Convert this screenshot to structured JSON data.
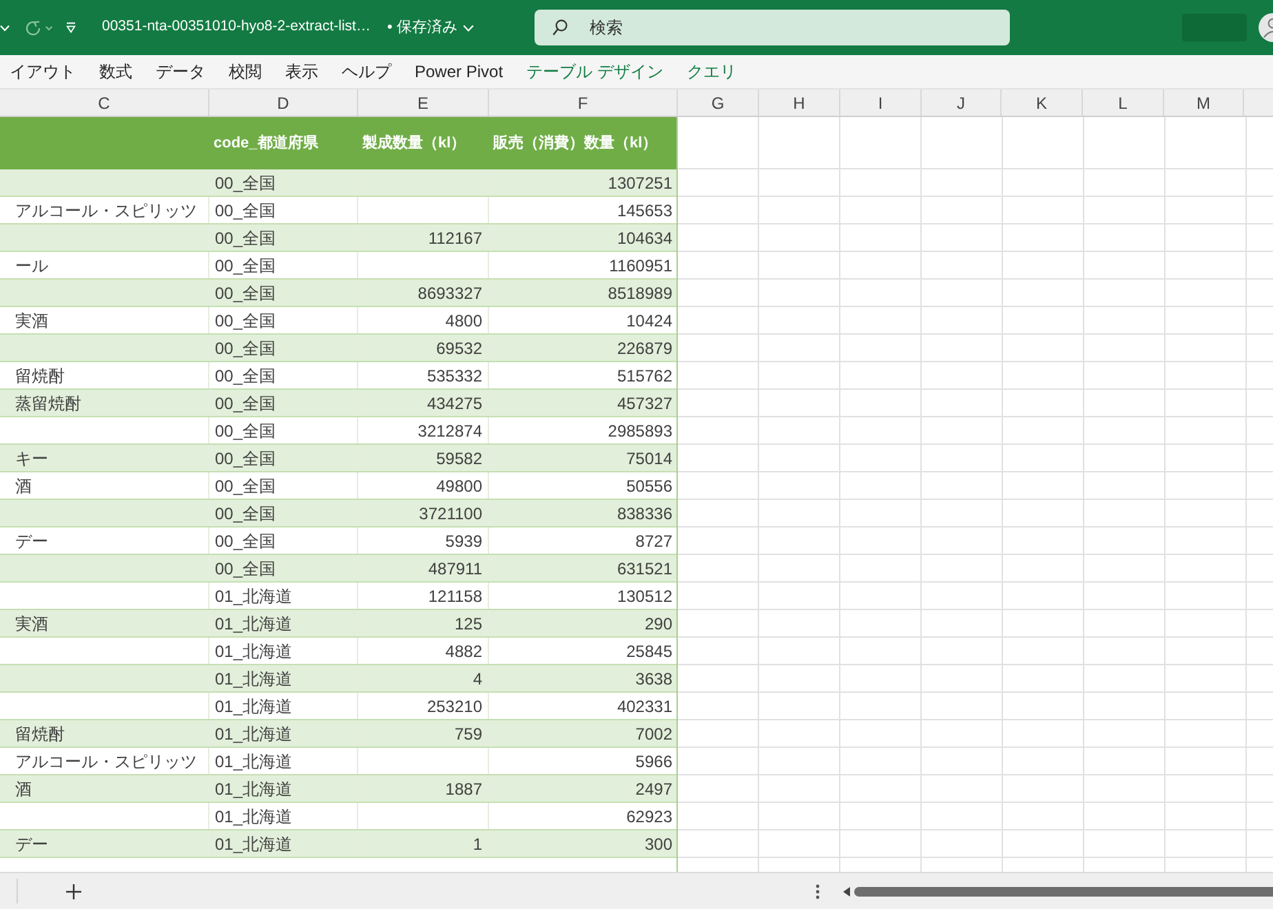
{
  "title_bar": {
    "file_name": "00351-nta-00351010-hyo8-2-extract-list…",
    "save_status": "• 保存済み",
    "search": {
      "placeholder": "検索"
    }
  },
  "ribbon_tabs": [
    {
      "label": "イアウト",
      "kind": "standard"
    },
    {
      "label": "数式",
      "kind": "standard"
    },
    {
      "label": "データ",
      "kind": "standard"
    },
    {
      "label": "校閲",
      "kind": "standard"
    },
    {
      "label": "表示",
      "kind": "standard"
    },
    {
      "label": "ヘルプ",
      "kind": "standard"
    },
    {
      "label": "Power Pivot",
      "kind": "standard"
    },
    {
      "label": "テーブル デザイン",
      "kind": "contextual"
    },
    {
      "label": "クエリ",
      "kind": "contextual"
    }
  ],
  "column_headers": [
    "C",
    "D",
    "E",
    "F",
    "G",
    "H",
    "I",
    "J",
    "K",
    "L",
    "M"
  ],
  "table": {
    "headings": [
      "code_都道府県",
      "製成数量（kl）",
      "販売（消費）数量（kl）"
    ],
    "rows": [
      {
        "prefecture_code": "00_全国",
        "sales": "1307251"
      },
      {
        "column_c": "アルコール・スピリッツ",
        "prefecture_code": "00_全国",
        "sales": "145653"
      },
      {
        "prefecture_code": "00_全国",
        "production": "112167",
        "sales": "104634"
      },
      {
        "column_c": "ール",
        "prefecture_code": "00_全国",
        "sales": "1160951"
      },
      {
        "prefecture_code": "00_全国",
        "production": "8693327",
        "sales": "8518989"
      },
      {
        "column_c": "実酒",
        "prefecture_code": "00_全国",
        "production": "4800",
        "sales": "10424"
      },
      {
        "prefecture_code": "00_全国",
        "production": "69532",
        "sales": "226879"
      },
      {
        "column_c": "留焼酎",
        "prefecture_code": "00_全国",
        "production": "535332",
        "sales": "515762"
      },
      {
        "column_c": "蒸留焼酎",
        "prefecture_code": "00_全国",
        "production": "434275",
        "sales": "457327"
      },
      {
        "prefecture_code": "00_全国",
        "production": "3212874",
        "sales": "2985893"
      },
      {
        "column_c": "キー",
        "prefecture_code": "00_全国",
        "production": "59582",
        "sales": "75014"
      },
      {
        "column_c": "酒",
        "prefecture_code": "00_全国",
        "production": "49800",
        "sales": "50556"
      },
      {
        "prefecture_code": "00_全国",
        "production": "3721100",
        "sales": "838336"
      },
      {
        "column_c": "デー",
        "prefecture_code": "00_全国",
        "production": "5939",
        "sales": "8727"
      },
      {
        "prefecture_code": "00_全国",
        "production": "487911",
        "sales": "631521"
      },
      {
        "prefecture_code": "01_北海道",
        "production": "121158",
        "sales": "130512"
      },
      {
        "column_c": "実酒",
        "prefecture_code": "01_北海道",
        "production": "125",
        "sales": "290"
      },
      {
        "prefecture_code": "01_北海道",
        "production": "4882",
        "sales": "25845"
      },
      {
        "prefecture_code": "01_北海道",
        "production": "4",
        "sales": "3638"
      },
      {
        "prefecture_code": "01_北海道",
        "production": "253210",
        "sales": "402331"
      },
      {
        "column_c": "留焼酎",
        "prefecture_code": "01_北海道",
        "production": "759",
        "sales": "7002"
      },
      {
        "column_c": "アルコール・スピリッツ",
        "prefecture_code": "01_北海道",
        "sales": "5966"
      },
      {
        "column_c": "酒",
        "prefecture_code": "01_北海道",
        "production": "1887",
        "sales": "2497"
      },
      {
        "prefecture_code": "01_北海道",
        "sales": "62923"
      },
      {
        "column_c": "デー",
        "prefecture_code": "01_北海道",
        "production": "1",
        "sales": "300"
      }
    ]
  }
}
